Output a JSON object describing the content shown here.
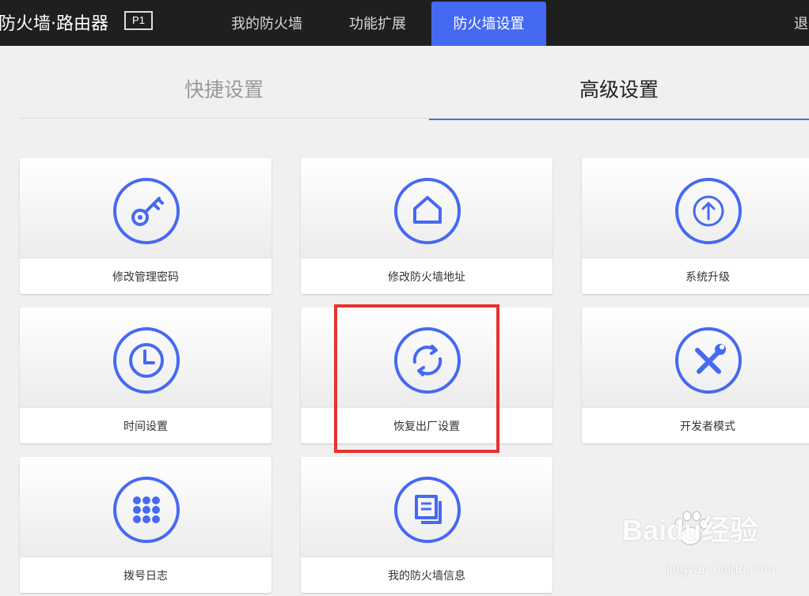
{
  "header": {
    "brand": "防火墙·路由器",
    "badge": "P1",
    "tabs": [
      {
        "label": "我的防火墙",
        "active": false
      },
      {
        "label": "功能扩展",
        "active": false
      },
      {
        "label": "防火墙设置",
        "active": true
      }
    ],
    "logout_label": "退"
  },
  "subtabs": {
    "quick": "快捷设置",
    "advanced": "高级设置",
    "selected": "advanced"
  },
  "cards": [
    {
      "label": "修改管理密码",
      "icon": "key-icon"
    },
    {
      "label": "修改防火墙地址",
      "icon": "home-icon"
    },
    {
      "label": "系统升级",
      "icon": "upload-arrow-icon"
    },
    {
      "label": "时间设置",
      "icon": "clock-icon"
    },
    {
      "label": "恢复出厂设置",
      "icon": "refresh-icon",
      "highlighted": true
    },
    {
      "label": "开发者模式",
      "icon": "tools-icon"
    },
    {
      "label": "拨号日志",
      "icon": "keypad-icon"
    },
    {
      "label": "我的防火墙信息",
      "icon": "documents-icon"
    }
  ],
  "watermark": {
    "logo": "Baidu经验",
    "url": "jingyan.baidu.com"
  },
  "colors": {
    "accent": "#4669f2",
    "topbar": "#1f1f1f",
    "highlight": "#e63232"
  }
}
